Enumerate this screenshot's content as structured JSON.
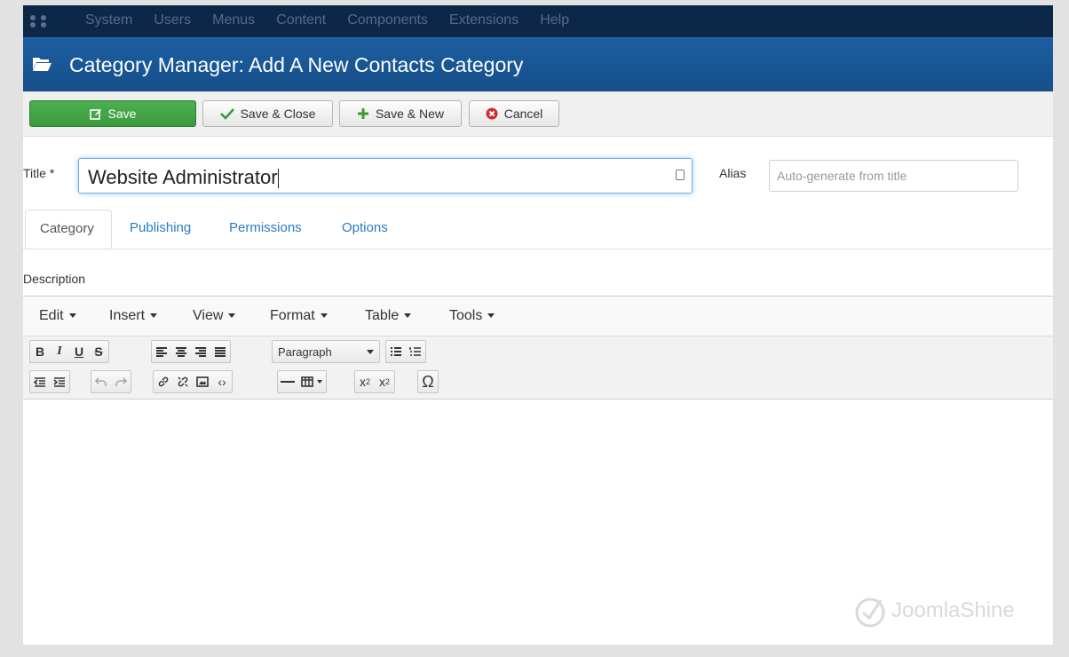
{
  "topnav": {
    "items": [
      "System",
      "Users",
      "Menus",
      "Content",
      "Components",
      "Extensions",
      "Help"
    ]
  },
  "header": {
    "title": "Category Manager: Add A New Contacts Category",
    "icon": "folder-open-icon"
  },
  "toolbar": {
    "save_label": "Save",
    "save_close_label": "Save & Close",
    "save_new_label": "Save & New",
    "cancel_label": "Cancel"
  },
  "form": {
    "title_label": "Title *",
    "title_value": "Website Administrator",
    "alias_label": "Alias",
    "alias_placeholder": "Auto-generate from title"
  },
  "tabs": [
    "Category",
    "Publishing",
    "Permissions",
    "Options"
  ],
  "description_label": "Description",
  "editor": {
    "menus": [
      "Edit",
      "Insert",
      "View",
      "Format",
      "Table",
      "Tools"
    ],
    "format_select": "Paragraph"
  },
  "watermark": "JoomlaShine",
  "colors": {
    "header": "#1c5ea1",
    "save": "#4caf50",
    "link": "#2a7bc4"
  }
}
